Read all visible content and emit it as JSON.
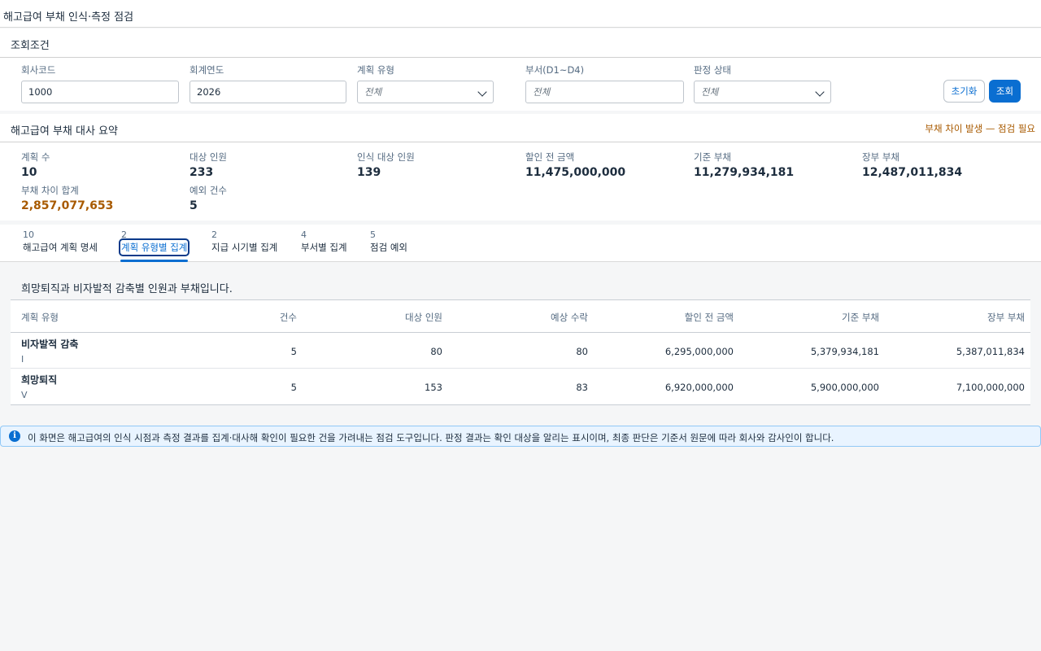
{
  "page": {
    "title": "해고급여 부채 인식·측정 점검"
  },
  "filters": {
    "section_title": "조회조건",
    "company_code": {
      "label": "회사코드",
      "value": "1000"
    },
    "fiscal_year": {
      "label": "회계연도",
      "value": "2026"
    },
    "plan_type": {
      "label": "계획 유형",
      "value": "전체"
    },
    "department": {
      "label": "부서(D1~D4)",
      "placeholder": "전체"
    },
    "judgment_status": {
      "label": "판정 상태",
      "value": "전체"
    },
    "reset_label": "초기화",
    "search_label": "조회"
  },
  "summary": {
    "section_title": "해고급여 부채 대사 요약",
    "warning": "부채 차이 발생 — 점검 필요",
    "warning_color": "#a85a00",
    "kpis": [
      {
        "label": "계획 수",
        "value": "10"
      },
      {
        "label": "대상 인원",
        "value": "233"
      },
      {
        "label": "인식 대상 인원",
        "value": "139"
      },
      {
        "label": "할인 전 금액",
        "value": "11,475,000,000"
      },
      {
        "label": "기준 부채",
        "value": "11,279,934,181"
      },
      {
        "label": "장부 부채",
        "value": "12,487,011,834"
      },
      {
        "label": "부채 차이 합계",
        "value": "2,857,077,653"
      },
      {
        "label": "예외 건수",
        "value": "5"
      }
    ]
  },
  "tabs": [
    {
      "count": "10",
      "label": "해고급여 계획 명세"
    },
    {
      "count": "2",
      "label": "계획 유형별 집계"
    },
    {
      "count": "2",
      "label": "지급 시기별 집계"
    },
    {
      "count": "4",
      "label": "부서별 집계"
    },
    {
      "count": "5",
      "label": "점검 예외"
    }
  ],
  "active_tab": "계획 유형별 집계",
  "content": {
    "description": "희망퇴직과 비자발적 감축별 인원과 부채입니다.",
    "columns": [
      "계획 유형",
      "건수",
      "대상 인원",
      "예상 수락",
      "할인 전 금액",
      "기준 부채",
      "장부 부채"
    ],
    "rows": [
      {
        "name": "비자발적 감축",
        "code": "I",
        "count": "5",
        "headcount": "80",
        "expected": "80",
        "undiscounted": "6,295,000,000",
        "base": "5,379,934,181",
        "book": "5,387,011,834"
      },
      {
        "name": "희망퇴직",
        "code": "V",
        "count": "5",
        "headcount": "153",
        "expected": "83",
        "undiscounted": "6,920,000,000",
        "base": "5,900,000,000",
        "book": "7,100,000,000"
      }
    ]
  },
  "info": {
    "icon": "info-icon",
    "text": "이 화면은 해고급여의 인식 시점과 측정 결과를 집계·대사해 확인이 필요한 건을 가려내는 점검 도구입니다. 판정 결과는 확인 대상을 알리는 표시이며, 최종 판단은 기준서 원문에 따라 회사와 감사인이 합니다."
  },
  "colors": {
    "accent": "#0a6ed1",
    "warning": "#a85a00",
    "info_bg": "#e9f4ff"
  }
}
